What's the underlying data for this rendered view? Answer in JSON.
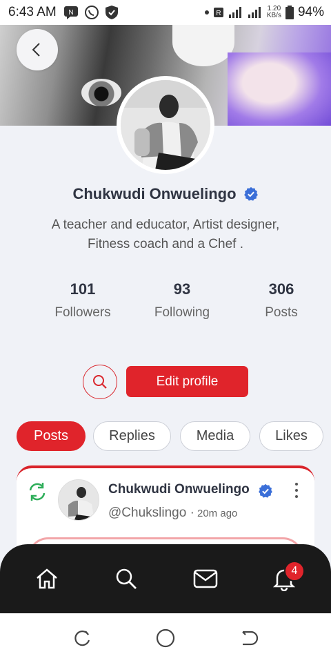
{
  "status_bar": {
    "time": "6:43 AM",
    "network_speed_value": "1.20",
    "network_speed_unit": "KB/s",
    "battery": "94%",
    "icons": [
      "message-icon",
      "whatsapp-icon",
      "shield-icon",
      "dot-icon",
      "roaming-icon",
      "signal-icon",
      "signal-icon",
      "battery-icon"
    ]
  },
  "profile": {
    "name": "Chukwudi Onwuelingo",
    "verified": true,
    "bio_line1": "A teacher and educator, Artist designer,",
    "bio_line2": "Fitness coach and a Chef .",
    "stats": [
      {
        "count": "101",
        "label": "Followers"
      },
      {
        "count": "93",
        "label": "Following"
      },
      {
        "count": "306",
        "label": "Posts"
      }
    ]
  },
  "actions": {
    "edit_profile": "Edit profile"
  },
  "tabs": [
    {
      "label": "Posts",
      "active": true
    },
    {
      "label": "Replies",
      "active": false
    },
    {
      "label": "Media",
      "active": false
    },
    {
      "label": "Likes",
      "active": false
    }
  ],
  "post": {
    "author": "Chukwudi Onwuelingo",
    "handle": "@Chukslingo",
    "separator": "·",
    "time": "20m ago"
  },
  "bottom_nav": {
    "items": [
      "home-icon",
      "search-icon",
      "mail-icon",
      "bell-icon"
    ],
    "notification_count": "4"
  },
  "colors": {
    "accent": "#e0242b",
    "verified": "#3b6fd8",
    "repost": "#2fae5a",
    "nav_bg": "#1a1a1a",
    "page_bg": "#f0f2f7"
  }
}
